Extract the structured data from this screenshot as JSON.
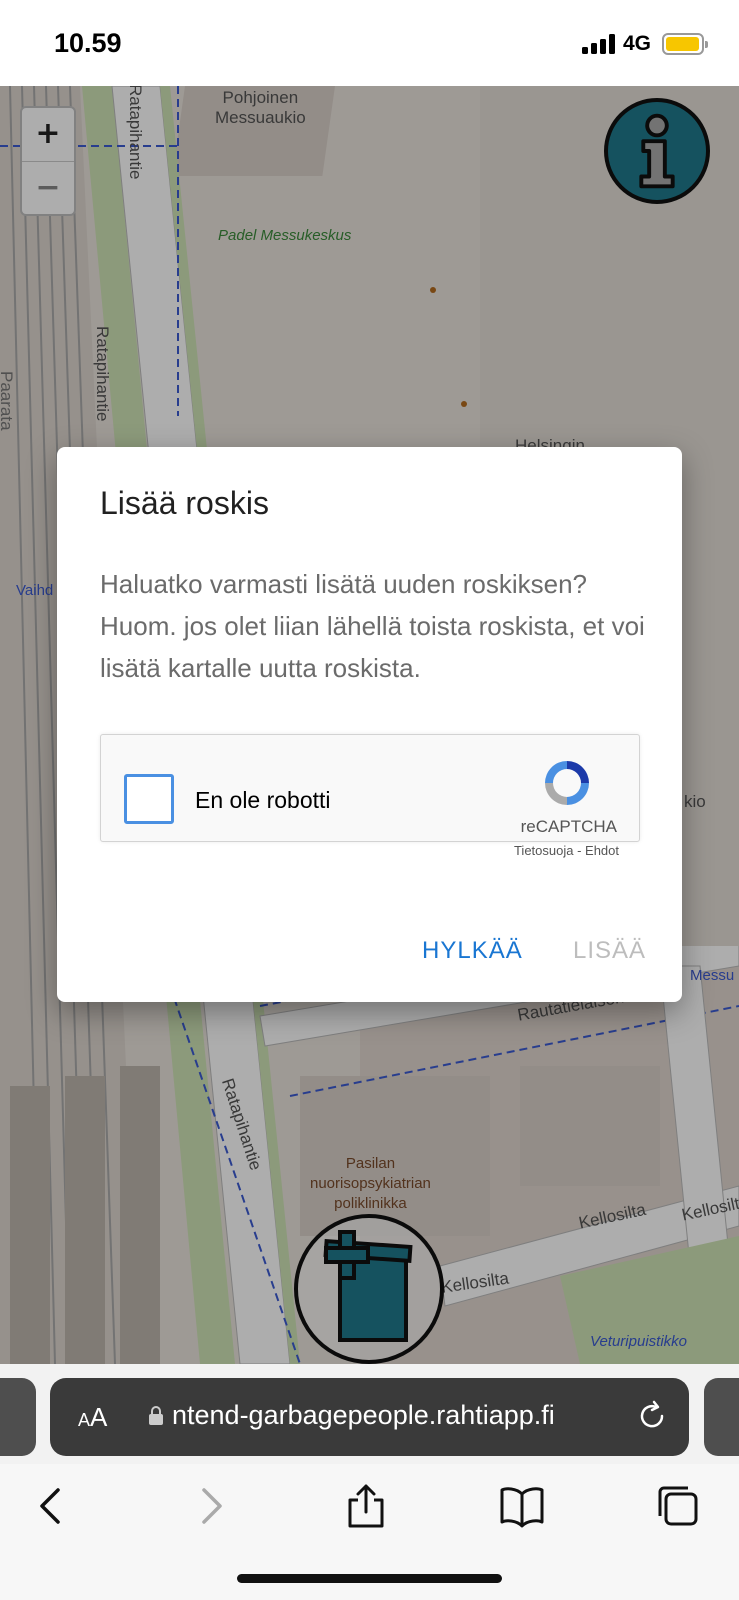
{
  "status": {
    "time": "10.59",
    "network": "4G"
  },
  "map": {
    "zoom_in": "+",
    "zoom_out": "−",
    "labels": {
      "pohjoinen": "Pohjoinen\nMessuaukio",
      "padel": "Padel Messukeskus",
      "ratapihantie_top": "Ratapihantie",
      "ratapihantie_mid": "Ratapihantie",
      "ratapihantie_bottom": "Ratapihantie",
      "helsingin": "Helsingin",
      "pasilan": "Pasilan\nnuorisopsykiatrian\npoliklinikka",
      "rautatielaisenkatu": "Rautatieläisenkatu",
      "kellosilta_1": "Kellosilta",
      "kellosilta_2": "Kellosilta",
      "kellosilta_3": "Kellosilta",
      "veturipuistikko": "Veturipuistikko",
      "paarata": "Paarata",
      "vaihd": "Vaihd",
      "kio": "kio",
      "messu": "Messu"
    }
  },
  "dialog": {
    "title": "Lisää roskis",
    "text_line1": "Haluatko varmasti lisätä uuden roskiksen?",
    "text_line2": "Huom. jos olet liian lähellä toista roskista, et voi lisätä kartalle uutta roskista.",
    "captcha_label": "En ole robotti",
    "captcha_brand": "reCAPTCHA",
    "captcha_links": "Tietosuoja - Ehdot",
    "cancel_label": "HYLKÄÄ",
    "add_label": "LISÄÄ"
  },
  "browser": {
    "text_size": "AA",
    "url": "ntend-garbagepeople.rahtiapp.fi"
  },
  "colors": {
    "accent": "#1976d2",
    "disabled": "#bdbdbd",
    "button_teal": "#1f7a8c"
  }
}
